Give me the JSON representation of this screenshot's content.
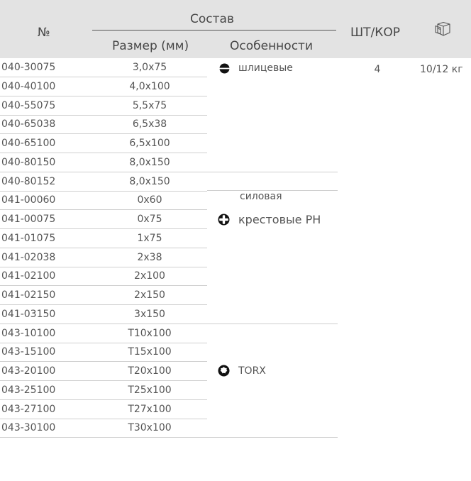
{
  "header": {
    "number_label": "№",
    "composition_label": "Состав",
    "size_label": "Размер (мм)",
    "features_label": "Особенности",
    "pcs_per_box_label": "ШТ/КОР",
    "box_icon": "box-3d-icon"
  },
  "rows": [
    {
      "code": "040-30075",
      "size": "3,0x75"
    },
    {
      "code": "040-40100",
      "size": "4,0x100"
    },
    {
      "code": "040-55075",
      "size": "5,5x75"
    },
    {
      "code": "040-65038",
      "size": "6,5x38"
    },
    {
      "code": "040-65100",
      "size": "6,5x100"
    },
    {
      "code": "040-80150",
      "size": "8,0x150"
    },
    {
      "code": "040-80152",
      "size": "8,0x150"
    },
    {
      "code": "041-00060",
      "size": "0x60"
    },
    {
      "code": "041-00075",
      "size": "0x75"
    },
    {
      "code": "041-01075",
      "size": "1x75"
    },
    {
      "code": "041-02038",
      "size": "2x38"
    },
    {
      "code": "041-02100",
      "size": "2x100"
    },
    {
      "code": "041-02150",
      "size": "2x150"
    },
    {
      "code": "041-03150",
      "size": "3x150"
    },
    {
      "code": "043-10100",
      "size": "T10x100"
    },
    {
      "code": "043-15100",
      "size": "T15x100"
    },
    {
      "code": "043-20100",
      "size": "T20x100"
    },
    {
      "code": "043-25100",
      "size": "T25x100"
    },
    {
      "code": "043-27100",
      "size": "T27x100"
    },
    {
      "code": "043-30100",
      "size": "T30x100"
    }
  ],
  "features": {
    "slotted": {
      "label": "шлицевые",
      "icon": "slotted-tip-icon"
    },
    "power": {
      "label": "силовая"
    },
    "phillips": {
      "label": "крестовые PH",
      "icon": "phillips-tip-icon"
    },
    "torx": {
      "label": "TORX",
      "icon": "torx-tip-icon"
    }
  },
  "pcs_per_box": "4",
  "box_weight": "10/12 кг"
}
